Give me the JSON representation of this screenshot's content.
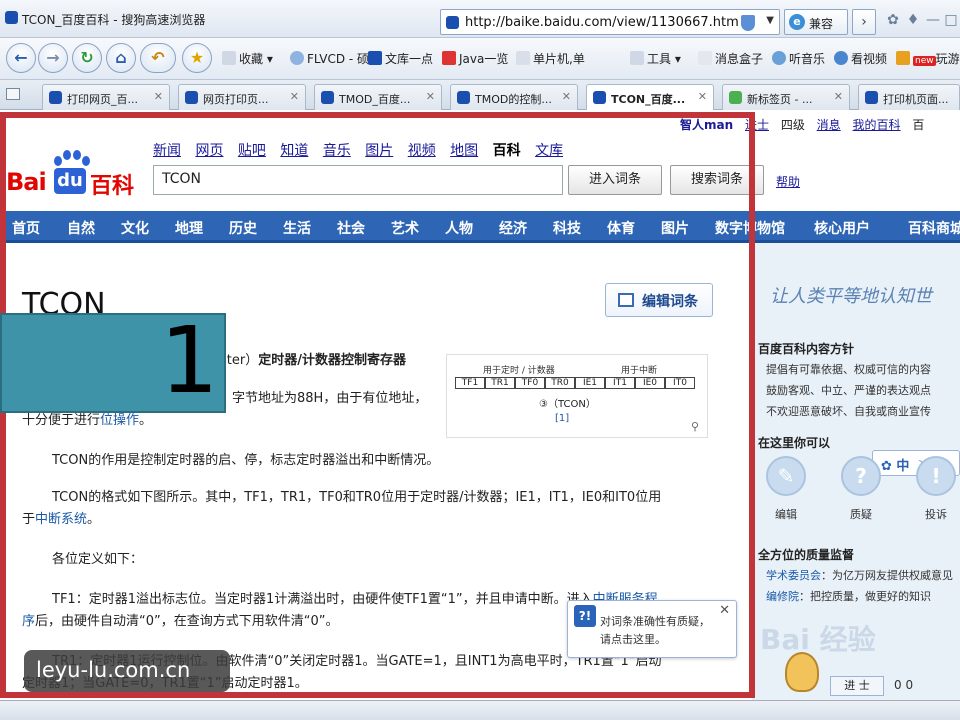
{
  "browser": {
    "window_title": "TCON_百度百科 - 搜狗高速浏览器",
    "address": "http://baike.baidu.com/view/1130667.htm",
    "compat_label": "兼容",
    "toolbar": {
      "favorites": "收藏",
      "flvcd": "FLVCD - 硕",
      "wenku": "文库一点",
      "java": "Java一览",
      "mcu": "单片机,单",
      "tools": "工具",
      "msgbox": "消息盒子",
      "music": "听音乐",
      "video": "看视频",
      "badge_new": "new",
      "games": "玩游"
    },
    "tabs": [
      {
        "label": "打印网页_百..."
      },
      {
        "label": "网页打印页..."
      },
      {
        "label": "TMOD_百度..."
      },
      {
        "label": "TMOD的控制..."
      },
      {
        "label": "TCON_百度..."
      },
      {
        "label": "新标签页 - ..."
      },
      {
        "label": "打印机页面..."
      }
    ]
  },
  "page": {
    "top_links": [
      "智人man",
      "进士",
      "四级",
      "消息",
      "我的百科",
      "百"
    ],
    "logo": {
      "bai": "Bai",
      "du": "du",
      "baike": "百科"
    },
    "nav_links": [
      "新闻",
      "网页",
      "贴吧",
      "知道",
      "音乐",
      "图片",
      "视频",
      "地图",
      "百科",
      "文库"
    ],
    "nav_current": "百科",
    "search_value": "TCON",
    "btn_enter": "进入词条",
    "btn_search": "搜索词条",
    "help": "帮助",
    "categories": [
      "首页",
      "自然",
      "文化",
      "地理",
      "历史",
      "生活",
      "社会",
      "艺术",
      "人物",
      "经济",
      "科技",
      "体育",
      "图片",
      "数字博物馆",
      "核心用户",
      "百科商城"
    ],
    "article": {
      "title": "TCON",
      "edit_label": "编辑词条",
      "lead_suffix": "ster）",
      "lead_bold": "定时器/计数器控制寄存器",
      "line2": "字节地址为88H，由于有位地址，",
      "line3_pre": "十分便于进行",
      "line3_link": "位操作",
      "line3_post": "。",
      "p1": "TCON的作用是控制定时器的启、停，标志定时器溢出和中断情况。",
      "p2": "TCON的格式如下图所示。其中，TF1，TR1，TF0和TR0位用于定时器/计数器；IE1，IT1，IE0和IT0位用",
      "p2b_pre": "于",
      "p2b_link": "中断系统",
      "p2b_post": "。",
      "p3": "各位定义如下：",
      "p4": "TF1：定时器1溢出标志位。当定时器1计满溢出时，由硬件使TF1置“1”，并且申请中断。进入",
      "p4_link": "中断服务程",
      "p5_link": "序",
      "p5": "后，由硬件自动清“0”，在查询方式下用软件清“0”。",
      "p6": "TR1：定时器1运行控制位。由软件清“0”关闭定时器1。当GATE=1，且INT1为高电平时，TR1置“1”启动",
      "p7": "定时器1；当GATE=0，TR1置“1”启动定时器1。"
    },
    "figure": {
      "hdr_left": "用于定时 / 计数器",
      "hdr_right": "用于中断",
      "bits": [
        "TF1",
        "TR1",
        "TF0",
        "TR0",
        "IE1",
        "IT1",
        "IE0",
        "IT0"
      ],
      "caption": "③（TCON）",
      "ref": "[1]"
    },
    "right_panel": {
      "slogan": "让人类平等地认知世",
      "principles_title": "百度百科内容方针",
      "principles": [
        "提倡有可靠依据、权威可信的内容",
        "鼓励客观、中立、严谨的表达观点",
        "不欢迎恶意破坏、自我或商业宣传"
      ],
      "can_do_title": "在这里你可以",
      "actions": [
        "编辑",
        "质疑",
        "投诉"
      ],
      "lang": "中",
      "quality_title": "全方位的质量监督",
      "committee_label": "学术委员会",
      "committee_text": "：为亿万网友提供权威意见",
      "editors_label": "编修院",
      "editors_text": "：把控质量，做更好的知识",
      "join_label": "进 士",
      "counts": "0 0"
    },
    "tooltip": {
      "line1": "对词条准确性有质疑，",
      "line2": "请点击这里。"
    }
  },
  "overlay": {
    "step_number": "1",
    "watermark": "leyu-lu.com.cn",
    "brand_watermark": "Bai 经验"
  },
  "colors": {
    "frame": "#c0343a",
    "step_box": "#3e93a8",
    "category_bar": "#2e66b5",
    "logo_red": "#e10602",
    "logo_blue": "#2d62d6"
  }
}
